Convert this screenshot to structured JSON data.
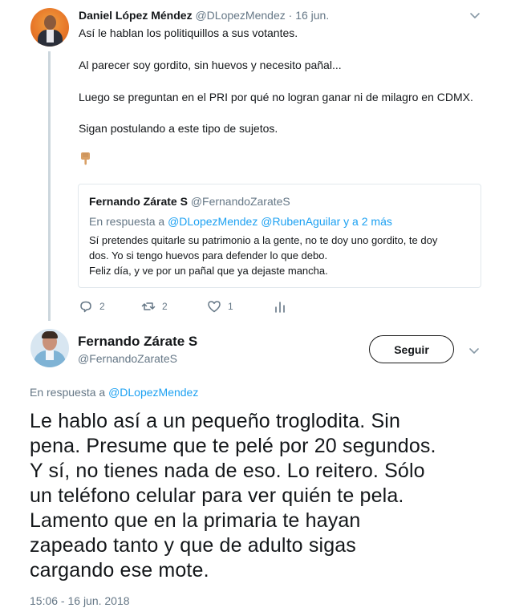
{
  "parent_tweet": {
    "author_name": "Daniel López Méndez",
    "author_handle": "@DLopezMendez",
    "separator": "·",
    "date": "16 jun.",
    "lines": [
      "Así le hablan los politiquillos a sus votantes.",
      "Al parecer soy gordito, sin huevos y necesito pañal...",
      "Luego se preguntan en el PRI por qué no logran ganar ni de milagro en CDMX.",
      "Sigan postulando a este tipo de sujetos."
    ],
    "emoji_icon": "pointing-down-hand-icon",
    "quoted": {
      "author_name": "Fernando Zárate S",
      "author_handle": "@FernandoZarateS",
      "reply_prefix": "En respuesta a",
      "reply_to": "@DLopezMendez @RubenAguilar y a 2 más",
      "lines": [
        "Sí pretendes quitarle su patrimonio a la gente, no te doy uno gordito, te doy",
        "dos. Yo si tengo huevos para defender lo que debo.",
        "Feliz día, y ve por un pañal que ya dejaste mancha."
      ]
    },
    "actions": {
      "reply_count": "2",
      "retweet_count": "2",
      "like_count": "1"
    }
  },
  "main_tweet": {
    "author_name": "Fernando Zárate S",
    "author_handle": "@FernandoZarateS",
    "follow_label": "Seguir",
    "reply_prefix": "En respuesta a",
    "reply_to": "@DLopezMendez",
    "lines": [
      "Le hablo así a un pequeño troglodita. Sin",
      "pena. Presume que te pelé por 20 segundos.",
      "Y sí, no tienes nada de eso. Lo reitero. Sólo",
      "un teléfono celular para ver quién te pela.",
      "Lamento que en la primaria te hayan",
      "zapeado tanto y que de adulto sigas",
      "cargando ese mote."
    ],
    "timestamp": "15:06 - 16 jun. 2018"
  },
  "colors": {
    "link": "#1da1f2",
    "secondary_text": "#657786",
    "primary_text": "#14171a",
    "thread_line": "#ccd6dd"
  }
}
